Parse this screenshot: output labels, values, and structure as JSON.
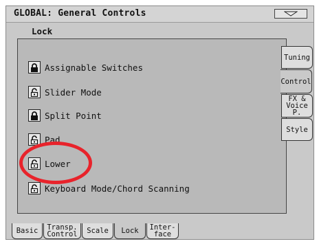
{
  "header": {
    "title": "GLOBAL: General Controls",
    "menu_icon": "triangle-down-icon"
  },
  "section": {
    "title": "Lock"
  },
  "lock_items": [
    {
      "label": "Assignable Switches",
      "state": "locked"
    },
    {
      "label": "Slider Mode",
      "state": "unlocked"
    },
    {
      "label": "Split Point",
      "state": "locked"
    },
    {
      "label": "Pad",
      "state": "unlocked"
    },
    {
      "label": "Lower",
      "state": "unlocked"
    },
    {
      "label": "Keyboard Mode/Chord Scanning",
      "state": "unlocked"
    }
  ],
  "side_tabs": [
    {
      "line1": "Tuning",
      "line2": ""
    },
    {
      "line1": "Control",
      "line2": "",
      "active": true
    },
    {
      "line1": "FX &",
      "line2": "Voice P."
    },
    {
      "line1": "Style",
      "line2": ""
    }
  ],
  "bottom_tabs": [
    {
      "line1": "Basic",
      "line2": ""
    },
    {
      "line1": "Transp.",
      "line2": "Control"
    },
    {
      "line1": "Scale",
      "line2": ""
    },
    {
      "line1": "Lock",
      "line2": "",
      "active": true
    },
    {
      "line1": "Inter-",
      "line2": "face"
    }
  ],
  "colors": {
    "highlight": "#e8232b",
    "screen_bg": "#c9c9c9",
    "panel_bg": "#b9b9b9"
  }
}
